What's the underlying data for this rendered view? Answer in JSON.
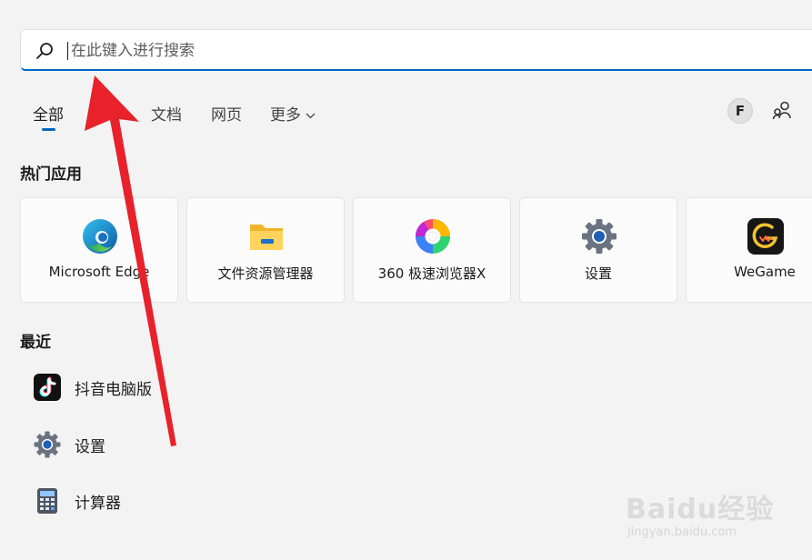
{
  "search": {
    "placeholder": "在此键入进行搜索",
    "accent_color": "#0067c0"
  },
  "tabs": [
    {
      "label": "全部",
      "active": true
    },
    {
      "label": "文档",
      "active": false
    },
    {
      "label": "网页",
      "active": false
    },
    {
      "label": "更多",
      "active": false,
      "has_dropdown": true
    }
  ],
  "account": {
    "avatar_initial": "F"
  },
  "top_apps": {
    "title": "热门应用",
    "items": [
      {
        "label": "Microsoft Edge",
        "icon": "edge-icon"
      },
      {
        "label": "文件资源管理器",
        "icon": "folder-icon"
      },
      {
        "label": "360 极速浏览器X",
        "icon": "browser-360-icon"
      },
      {
        "label": "设置",
        "icon": "gear-icon"
      },
      {
        "label": "WeGame",
        "icon": "wegame-icon"
      }
    ]
  },
  "recent": {
    "title": "最近",
    "items": [
      {
        "label": "抖音电脑版",
        "icon": "tiktok-icon"
      },
      {
        "label": "设置",
        "icon": "gear-icon"
      },
      {
        "label": "计算器",
        "icon": "calculator-icon"
      }
    ]
  },
  "annotation": {
    "arrow_color": "#e8212b"
  },
  "watermark": {
    "main": "Baidu经验",
    "sub": "jingyan.baidu.com"
  }
}
